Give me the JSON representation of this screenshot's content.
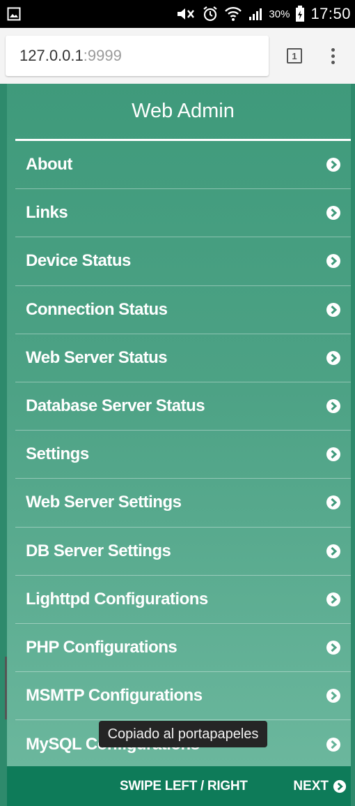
{
  "status_bar": {
    "battery_percent": "30%",
    "time": "17:50",
    "icons": [
      "image-icon",
      "mute-icon",
      "alarm-icon",
      "wifi-icon",
      "signal-icon",
      "battery-icon"
    ]
  },
  "browser": {
    "url_host": "127.0.0.1",
    "url_port": ":9999",
    "tab_count": "1"
  },
  "app": {
    "title": "Web Admin",
    "menu": [
      {
        "label": "About"
      },
      {
        "label": "Links"
      },
      {
        "label": "Device Status"
      },
      {
        "label": "Connection Status"
      },
      {
        "label": "Web Server Status"
      },
      {
        "label": "Database Server Status"
      },
      {
        "label": "Settings"
      },
      {
        "label": "Web Server Settings"
      },
      {
        "label": "DB Server Settings"
      },
      {
        "label": "Lighttpd Configurations"
      },
      {
        "label": "PHP Configurations"
      },
      {
        "label": "MSMTP Configurations"
      },
      {
        "label": "MySQL Configurations"
      }
    ],
    "footer": {
      "swipe_hint": "SWIPE LEFT / RIGHT",
      "next_label": "NEXT"
    }
  },
  "toast": {
    "message": "Copiado al portapapeles"
  },
  "colors": {
    "accent": "#2e8a6c",
    "footer": "#0e7b59",
    "toast_bg": "#252525"
  }
}
